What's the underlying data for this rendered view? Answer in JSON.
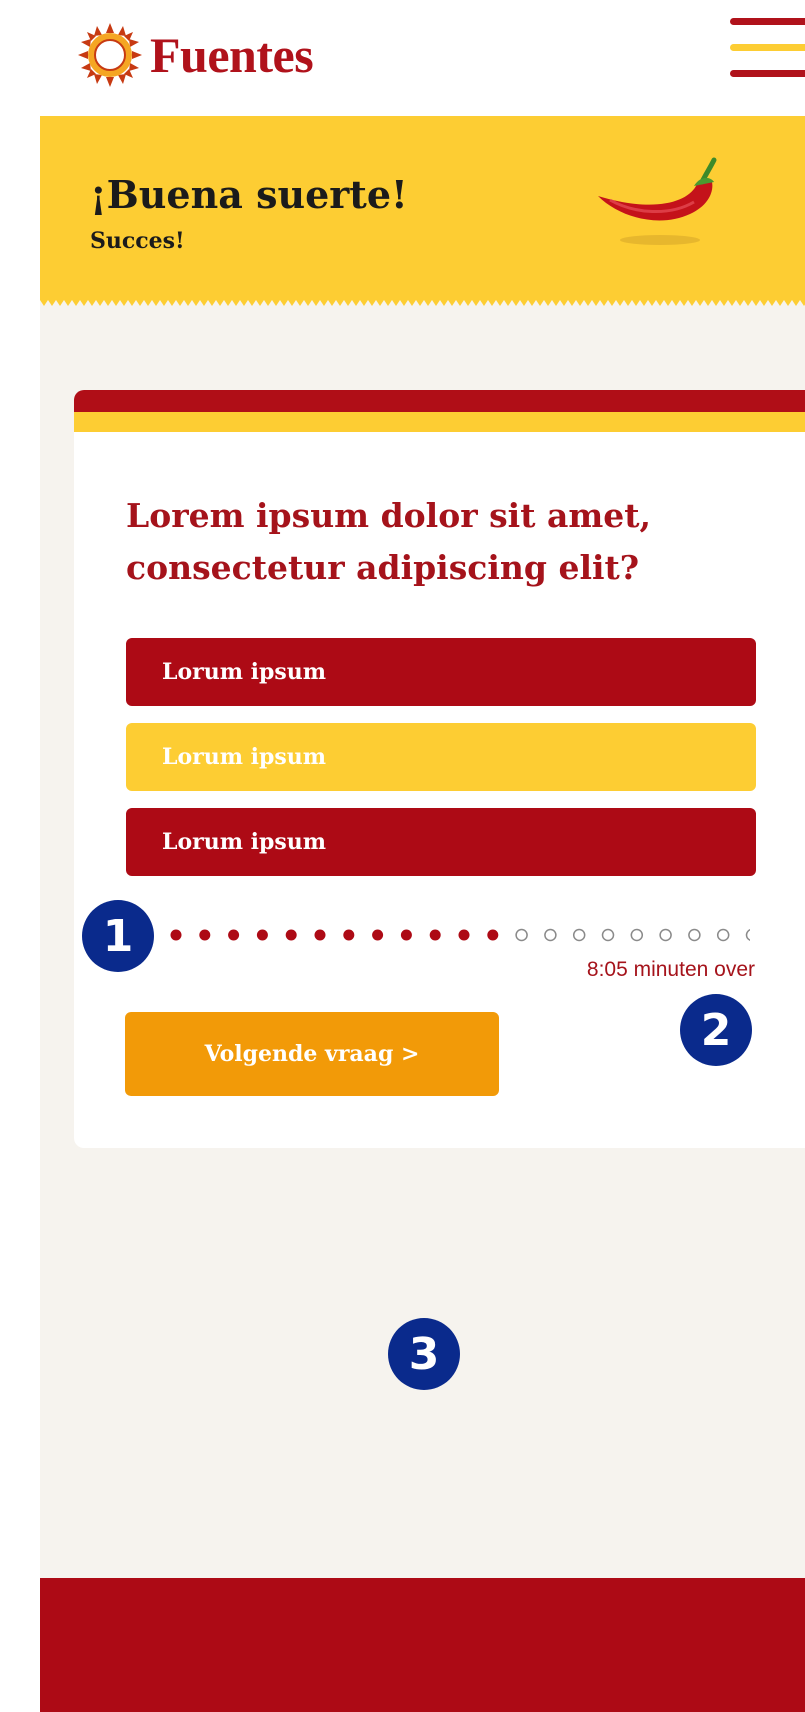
{
  "header": {
    "logo_text": "Fuentes",
    "logo_icon": "sun-icon",
    "menu_icon": "hamburger-menu-icon"
  },
  "banner": {
    "title": "¡Buena suerte!",
    "subtitle": "Succes!",
    "image": "chili-pepper"
  },
  "quiz": {
    "question": "Lorem ipsum dolor sit amet, consectetur adipiscing elit?",
    "answers": [
      {
        "label": "Lorum ipsum",
        "style": "red"
      },
      {
        "label": "Lorum ipsum",
        "style": "yellow"
      },
      {
        "label": "Lorum ipsum",
        "style": "red"
      }
    ],
    "progress": {
      "answered": 12,
      "total": 21
    },
    "timer": "8:05 minuten over",
    "next_label": "Volgende vraag >"
  },
  "annotations": {
    "badge1": "1",
    "badge2": "2",
    "badge3": "3"
  },
  "colors": {
    "brand_red": "#ad0a15",
    "brand_yellow": "#fdcd33",
    "button_orange": "#f29a08",
    "badge_blue": "#0a2a8c",
    "page_bg": "#f6f3ee"
  }
}
